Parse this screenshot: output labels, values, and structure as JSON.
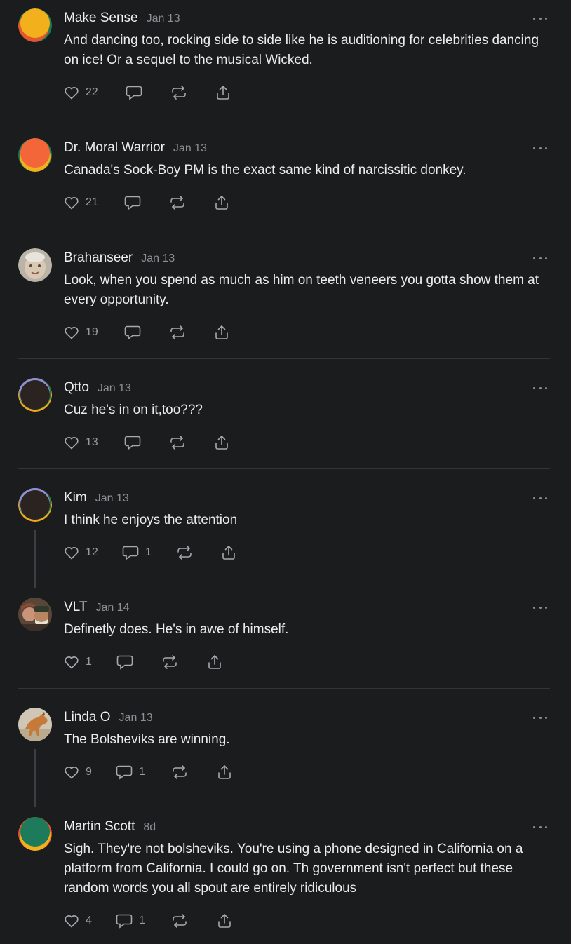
{
  "comments": [
    {
      "author": "Make Sense",
      "date": "Jan 13",
      "text": "And dancing too, rocking side to side like he is auditioning for celebrities dancing on ice! Or a sequel to the musical Wicked.",
      "likes": "22",
      "replies": "",
      "avatar": "multicolor"
    },
    {
      "author": "Dr. Moral Warrior",
      "date": "Jan 13",
      "text": "Canada's Sock-Boy PM is the exact same kind of narcissitic donkey.",
      "likes": "21",
      "replies": "",
      "avatar": "multicolor"
    },
    {
      "author": "Brahanseer",
      "date": "Jan 13",
      "text": "Look, when you spend as much as him on teeth veneers you gotta show them at every opportunity.",
      "likes": "19",
      "replies": "",
      "avatar": "photo"
    },
    {
      "author": "Qtto",
      "date": "Jan 13",
      "text": "Cuz he's in on it,too???",
      "likes": "13",
      "replies": "",
      "avatar": "multicolor"
    },
    {
      "author": "Kim",
      "date": "Jan 13",
      "text": "I think he enjoys the attention",
      "likes": "12",
      "replies": "1",
      "avatar": "multicolor"
    },
    {
      "author": "VLT",
      "date": "Jan 14",
      "text": "Definetly does. He's in awe of himself.",
      "likes": "1",
      "replies": "",
      "avatar": "photo"
    },
    {
      "author": "Linda O",
      "date": "Jan 13",
      "text": "The Bolsheviks are winning.",
      "likes": "9",
      "replies": "1",
      "avatar": "photo"
    },
    {
      "author": "Martin Scott",
      "date": "8d",
      "text": "Sigh. They're not bolsheviks. You're using a phone designed in California on a platform from California. I could go on. Th government isn't perfect but these random words you all spout are entirely ridiculous",
      "likes": "4",
      "replies": "1",
      "avatar": "multicolor"
    }
  ],
  "colors": {
    "background": "#1b1c1e",
    "text": "#ececec",
    "muted": "#8e8f93",
    "divider": "#333438"
  }
}
